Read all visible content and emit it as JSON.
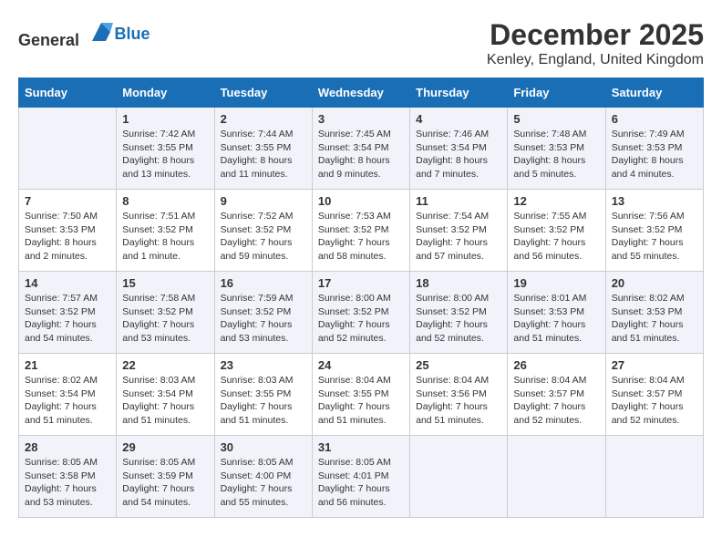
{
  "header": {
    "logo_general": "General",
    "logo_blue": "Blue",
    "month": "December 2025",
    "location": "Kenley, England, United Kingdom"
  },
  "weekdays": [
    "Sunday",
    "Monday",
    "Tuesday",
    "Wednesday",
    "Thursday",
    "Friday",
    "Saturday"
  ],
  "weeks": [
    [
      {
        "day": "",
        "info": ""
      },
      {
        "day": "1",
        "info": "Sunrise: 7:42 AM\nSunset: 3:55 PM\nDaylight: 8 hours\nand 13 minutes."
      },
      {
        "day": "2",
        "info": "Sunrise: 7:44 AM\nSunset: 3:55 PM\nDaylight: 8 hours\nand 11 minutes."
      },
      {
        "day": "3",
        "info": "Sunrise: 7:45 AM\nSunset: 3:54 PM\nDaylight: 8 hours\nand 9 minutes."
      },
      {
        "day": "4",
        "info": "Sunrise: 7:46 AM\nSunset: 3:54 PM\nDaylight: 8 hours\nand 7 minutes."
      },
      {
        "day": "5",
        "info": "Sunrise: 7:48 AM\nSunset: 3:53 PM\nDaylight: 8 hours\nand 5 minutes."
      },
      {
        "day": "6",
        "info": "Sunrise: 7:49 AM\nSunset: 3:53 PM\nDaylight: 8 hours\nand 4 minutes."
      }
    ],
    [
      {
        "day": "7",
        "info": "Sunrise: 7:50 AM\nSunset: 3:53 PM\nDaylight: 8 hours\nand 2 minutes."
      },
      {
        "day": "8",
        "info": "Sunrise: 7:51 AM\nSunset: 3:52 PM\nDaylight: 8 hours\nand 1 minute."
      },
      {
        "day": "9",
        "info": "Sunrise: 7:52 AM\nSunset: 3:52 PM\nDaylight: 7 hours\nand 59 minutes."
      },
      {
        "day": "10",
        "info": "Sunrise: 7:53 AM\nSunset: 3:52 PM\nDaylight: 7 hours\nand 58 minutes."
      },
      {
        "day": "11",
        "info": "Sunrise: 7:54 AM\nSunset: 3:52 PM\nDaylight: 7 hours\nand 57 minutes."
      },
      {
        "day": "12",
        "info": "Sunrise: 7:55 AM\nSunset: 3:52 PM\nDaylight: 7 hours\nand 56 minutes."
      },
      {
        "day": "13",
        "info": "Sunrise: 7:56 AM\nSunset: 3:52 PM\nDaylight: 7 hours\nand 55 minutes."
      }
    ],
    [
      {
        "day": "14",
        "info": "Sunrise: 7:57 AM\nSunset: 3:52 PM\nDaylight: 7 hours\nand 54 minutes."
      },
      {
        "day": "15",
        "info": "Sunrise: 7:58 AM\nSunset: 3:52 PM\nDaylight: 7 hours\nand 53 minutes."
      },
      {
        "day": "16",
        "info": "Sunrise: 7:59 AM\nSunset: 3:52 PM\nDaylight: 7 hours\nand 53 minutes."
      },
      {
        "day": "17",
        "info": "Sunrise: 8:00 AM\nSunset: 3:52 PM\nDaylight: 7 hours\nand 52 minutes."
      },
      {
        "day": "18",
        "info": "Sunrise: 8:00 AM\nSunset: 3:52 PM\nDaylight: 7 hours\nand 52 minutes."
      },
      {
        "day": "19",
        "info": "Sunrise: 8:01 AM\nSunset: 3:53 PM\nDaylight: 7 hours\nand 51 minutes."
      },
      {
        "day": "20",
        "info": "Sunrise: 8:02 AM\nSunset: 3:53 PM\nDaylight: 7 hours\nand 51 minutes."
      }
    ],
    [
      {
        "day": "21",
        "info": "Sunrise: 8:02 AM\nSunset: 3:54 PM\nDaylight: 7 hours\nand 51 minutes."
      },
      {
        "day": "22",
        "info": "Sunrise: 8:03 AM\nSunset: 3:54 PM\nDaylight: 7 hours\nand 51 minutes."
      },
      {
        "day": "23",
        "info": "Sunrise: 8:03 AM\nSunset: 3:55 PM\nDaylight: 7 hours\nand 51 minutes."
      },
      {
        "day": "24",
        "info": "Sunrise: 8:04 AM\nSunset: 3:55 PM\nDaylight: 7 hours\nand 51 minutes."
      },
      {
        "day": "25",
        "info": "Sunrise: 8:04 AM\nSunset: 3:56 PM\nDaylight: 7 hours\nand 51 minutes."
      },
      {
        "day": "26",
        "info": "Sunrise: 8:04 AM\nSunset: 3:57 PM\nDaylight: 7 hours\nand 52 minutes."
      },
      {
        "day": "27",
        "info": "Sunrise: 8:04 AM\nSunset: 3:57 PM\nDaylight: 7 hours\nand 52 minutes."
      }
    ],
    [
      {
        "day": "28",
        "info": "Sunrise: 8:05 AM\nSunset: 3:58 PM\nDaylight: 7 hours\nand 53 minutes."
      },
      {
        "day": "29",
        "info": "Sunrise: 8:05 AM\nSunset: 3:59 PM\nDaylight: 7 hours\nand 54 minutes."
      },
      {
        "day": "30",
        "info": "Sunrise: 8:05 AM\nSunset: 4:00 PM\nDaylight: 7 hours\nand 55 minutes."
      },
      {
        "day": "31",
        "info": "Sunrise: 8:05 AM\nSunset: 4:01 PM\nDaylight: 7 hours\nand 56 minutes."
      },
      {
        "day": "",
        "info": ""
      },
      {
        "day": "",
        "info": ""
      },
      {
        "day": "",
        "info": ""
      }
    ]
  ]
}
